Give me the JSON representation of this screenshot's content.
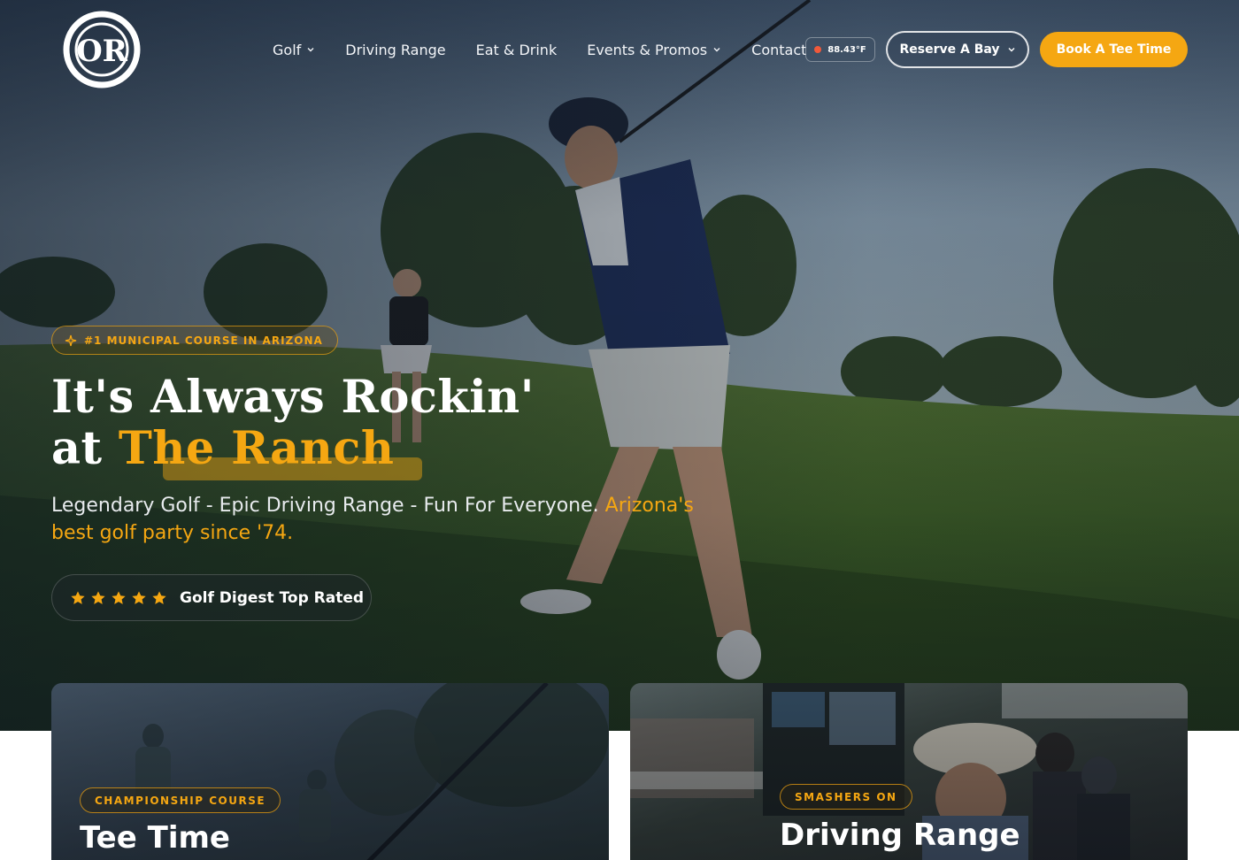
{
  "brand": {
    "logo_initials": "OR",
    "logo_arc_text": "ORANGE RANCH GC"
  },
  "nav": {
    "items": [
      {
        "label": "Golf",
        "has_dropdown": true
      },
      {
        "label": "Driving Range",
        "has_dropdown": false
      },
      {
        "label": "Eat & Drink",
        "has_dropdown": false
      },
      {
        "label": "Events & Promos",
        "has_dropdown": true
      },
      {
        "label": "Contact",
        "has_dropdown": false
      }
    ],
    "weather": "88.43°F",
    "reserve_label": "Reserve A Bay",
    "book_label": "Book A Tee Time"
  },
  "hero": {
    "badge": "#1 MUNICIPAL COURSE IN ARIZONA",
    "headline_line1": "It's Always Rockin'",
    "headline_line2_prefix": "at ",
    "headline_accent": "The Ranch",
    "subtext_main": "Legendary Golf - Epic Driving Range - Fun For Everyone. ",
    "subtext_highlight": "Arizona's best golf party since '74.",
    "rating_stars": 5,
    "rating_label": "Golf Digest Top Rated"
  },
  "cards": [
    {
      "tag": "CHAMPIONSHIP COURSE",
      "title": "Tee Time"
    },
    {
      "tag": "SMASHERS ON",
      "title": "Driving Range"
    }
  ],
  "colors": {
    "accent": "#f5a712",
    "weather_dot": "#f0593a",
    "text_light": "#ffffff"
  }
}
